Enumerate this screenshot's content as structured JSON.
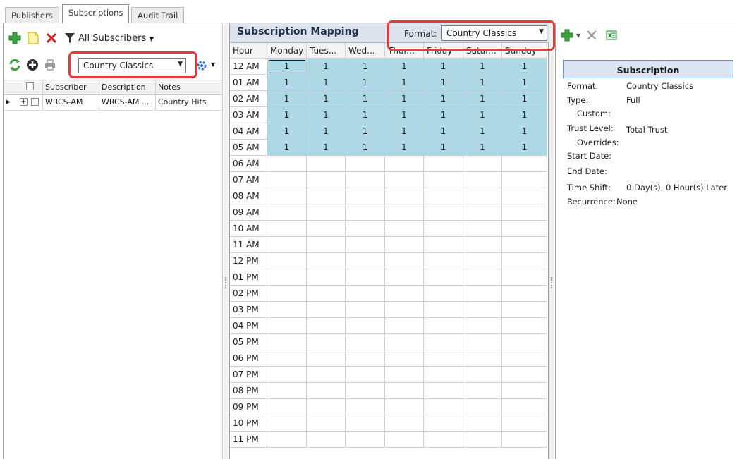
{
  "tabs": [
    {
      "label": "Publishers"
    },
    {
      "label": "Subscriptions"
    },
    {
      "label": "Audit Trail"
    }
  ],
  "left": {
    "filter_label": "All Subscribers",
    "format_combo_value": "Country Classics",
    "columns": [
      "Subscriber",
      "Description",
      "Notes"
    ],
    "rows": [
      {
        "subscriber": "WRCS-AM",
        "description": "WRCS-AM ...",
        "notes": "Country Hits"
      }
    ]
  },
  "mapping": {
    "title": "Subscription Mapping",
    "format_label": "Format:",
    "format_value": "Country Classics",
    "hour_header": "Hour",
    "days": [
      "Monday",
      "Tues...",
      "Wed...",
      "Thur...",
      "Friday",
      "Satur...",
      "Sunday"
    ],
    "hours": [
      "12 AM",
      "01 AM",
      "02 AM",
      "03 AM",
      "04 AM",
      "05 AM",
      "06 AM",
      "07 AM",
      "08 AM",
      "09 AM",
      "10 AM",
      "11 AM",
      "12 PM",
      "01 PM",
      "02 PM",
      "03 PM",
      "04 PM",
      "05 PM",
      "06 PM",
      "07 PM",
      "08 PM",
      "09 PM",
      "10 PM",
      "11 PM"
    ],
    "values": [
      [
        "1",
        "1",
        "1",
        "1",
        "1",
        "1",
        "1"
      ],
      [
        "1",
        "1",
        "1",
        "1",
        "1",
        "1",
        "1"
      ],
      [
        "1",
        "1",
        "1",
        "1",
        "1",
        "1",
        "1"
      ],
      [
        "1",
        "1",
        "1",
        "1",
        "1",
        "1",
        "1"
      ],
      [
        "1",
        "1",
        "1",
        "1",
        "1",
        "1",
        "1"
      ],
      [
        "1",
        "1",
        "1",
        "1",
        "1",
        "1",
        "1"
      ],
      [],
      [],
      [],
      [],
      [],
      [],
      [],
      [],
      [],
      [],
      [],
      [],
      [],
      [],
      [],
      [],
      [],
      []
    ]
  },
  "subscription": {
    "header": "Subscription",
    "format_label": "Format:",
    "format_value": "Country Classics",
    "type_label": "Type:",
    "type_value": "Full",
    "custom_label": "Custom:",
    "trust_label": "Trust Level:",
    "trust_value": "Total Trust",
    "overrides_label": "Overrides:",
    "start_label": "Start Date:",
    "end_label": "End Date:",
    "timeshift_label": "Time Shift:",
    "timeshift_value": "0 Day(s), 0 Hour(s) Later",
    "recurrence_label": "Recurrence:",
    "recurrence_value": "None"
  },
  "colors": {
    "highlight": "#e63a3a",
    "filled_cell": "#add8e6",
    "add_green": "#3aa23a",
    "delete_red": "#d02020"
  },
  "icons": {
    "add": "add-icon",
    "new": "new-document-icon",
    "delete": "delete-icon",
    "filter": "filter-icon",
    "refresh": "refresh-icon",
    "add_circle": "add-circle-icon",
    "print": "print-icon",
    "settings": "settings-gear-icon",
    "clear": "clear-icon",
    "excel": "excel-icon"
  }
}
